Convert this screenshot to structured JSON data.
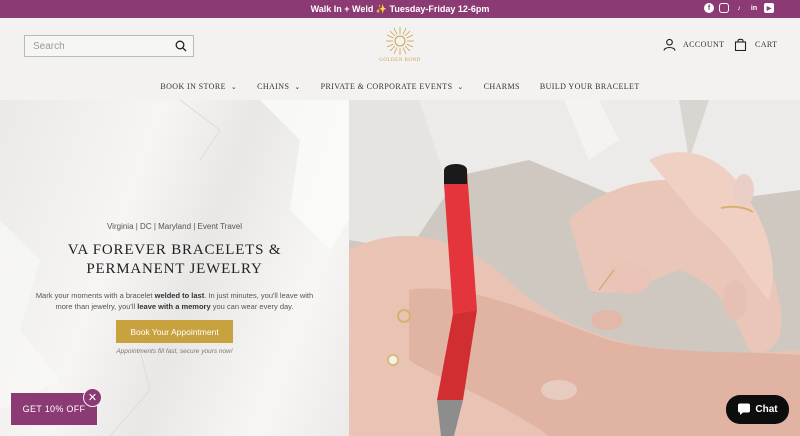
{
  "announcement": {
    "text": "Walk In + Weld ✨ Tuesday-Friday 12-6pm"
  },
  "social": [
    {
      "name": "facebook-icon",
      "glyph": "f"
    },
    {
      "name": "instagram-icon",
      "glyph": ""
    },
    {
      "name": "tiktok-icon",
      "glyph": "♪"
    },
    {
      "name": "linkedin-icon",
      "glyph": "in"
    },
    {
      "name": "youtube-icon",
      "glyph": "▶"
    }
  ],
  "header": {
    "search_placeholder": "Search",
    "logo_text": "GOLDEN BOND",
    "account_label": "ACCOUNT",
    "cart_label": "CART"
  },
  "nav": {
    "items": [
      {
        "label": "BOOK IN STORE",
        "has_dropdown": true
      },
      {
        "label": "CHAINS",
        "has_dropdown": true
      },
      {
        "label": "PRIVATE & CORPORATE EVENTS",
        "has_dropdown": true
      },
      {
        "label": "CHARMS",
        "has_dropdown": false
      },
      {
        "label": "BUILD YOUR BRACELET",
        "has_dropdown": false
      }
    ],
    "chevron": "⌄"
  },
  "hero": {
    "eyebrow": "Virginia | DC | Maryland | Event Travel",
    "headline_line1": "VA FOREVER BRACELETS &",
    "headline_line2": "PERMANENT JEWELRY",
    "body_part1": "Mark your moments with a bracelet ",
    "body_bold1": "welded to last",
    "body_part2": ". In just minutes, you'll leave with more than jewelry, you'll ",
    "body_bold2": "leave with a memory",
    "body_part3": " you can wear every day.",
    "cta_label": "Book Your Appointment",
    "note": "Appointments fill fast, secure yours now!"
  },
  "promo": {
    "label": "GET 10% OFF",
    "close_glyph": "✕"
  },
  "chat": {
    "label": "Chat"
  },
  "colors": {
    "brand": "#8b3a74",
    "gold": "#c8a23f",
    "chat": "#0d0d0d"
  }
}
